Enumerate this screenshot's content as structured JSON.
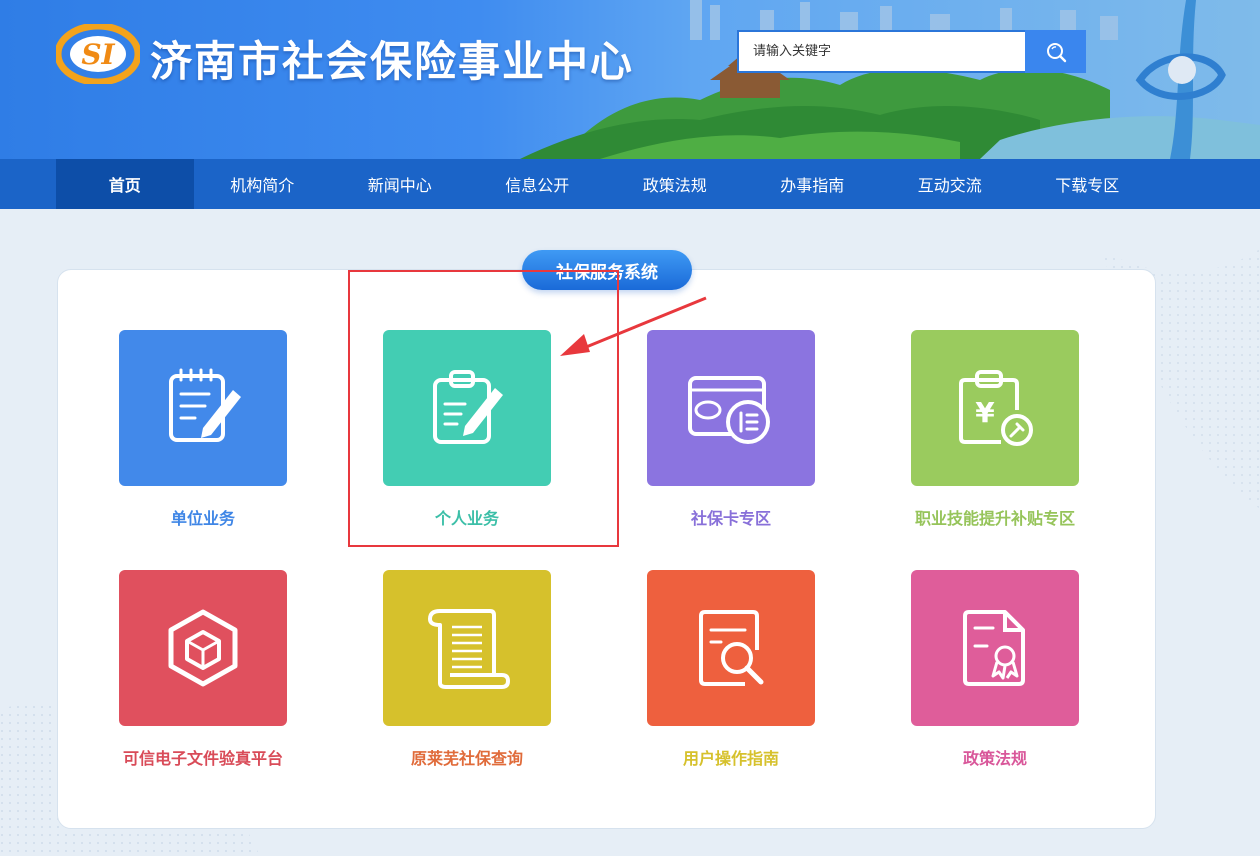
{
  "header": {
    "title": "济南市社会保险事业中心",
    "logo_text": "SI",
    "search_placeholder": "请输入关键字",
    "search_icon": "search-icon"
  },
  "nav": {
    "items": [
      {
        "label": "首页",
        "active": true
      },
      {
        "label": "机构简介"
      },
      {
        "label": "新闻中心"
      },
      {
        "label": "信息公开"
      },
      {
        "label": "政策法规"
      },
      {
        "label": "办事指南"
      },
      {
        "label": "互动交流"
      },
      {
        "label": "下载专区"
      }
    ]
  },
  "services": {
    "section_title": "社保服务系统",
    "tiles": [
      {
        "label": "单位业务",
        "color": "#4289ea",
        "text_color": "#3f86e6",
        "icon": "document-edit-icon"
      },
      {
        "label": "个人业务",
        "color": "#43cdb3",
        "text_color": "#3cbfa8",
        "icon": "clipboard-edit-icon"
      },
      {
        "label": "社保卡专区",
        "color": "#8b74e0",
        "text_color": "#8870d9",
        "icon": "social-card-icon"
      },
      {
        "label": "职业技能提升补贴专区",
        "color": "#9acb5e",
        "text_color": "#96c45a",
        "icon": "subsidy-clipboard-icon"
      },
      {
        "label": "可信电子文件验真平台",
        "color": "#e0505e",
        "text_color": "#d94b58",
        "icon": "cube-verify-icon"
      },
      {
        "label": "原莱芜社保查询",
        "color": "#d6c12c",
        "text_color": "#e06b3a",
        "icon": "scroll-icon"
      },
      {
        "label": "用户操作指南",
        "color": "#ee603e",
        "text_color": "#d6c12c",
        "icon": "document-search-icon"
      },
      {
        "label": "政策法规",
        "color": "#df5d9a",
        "text_color": "#d9579a",
        "icon": "certificate-icon"
      }
    ]
  },
  "annotation": {
    "highlight_color": "#e8383d"
  }
}
